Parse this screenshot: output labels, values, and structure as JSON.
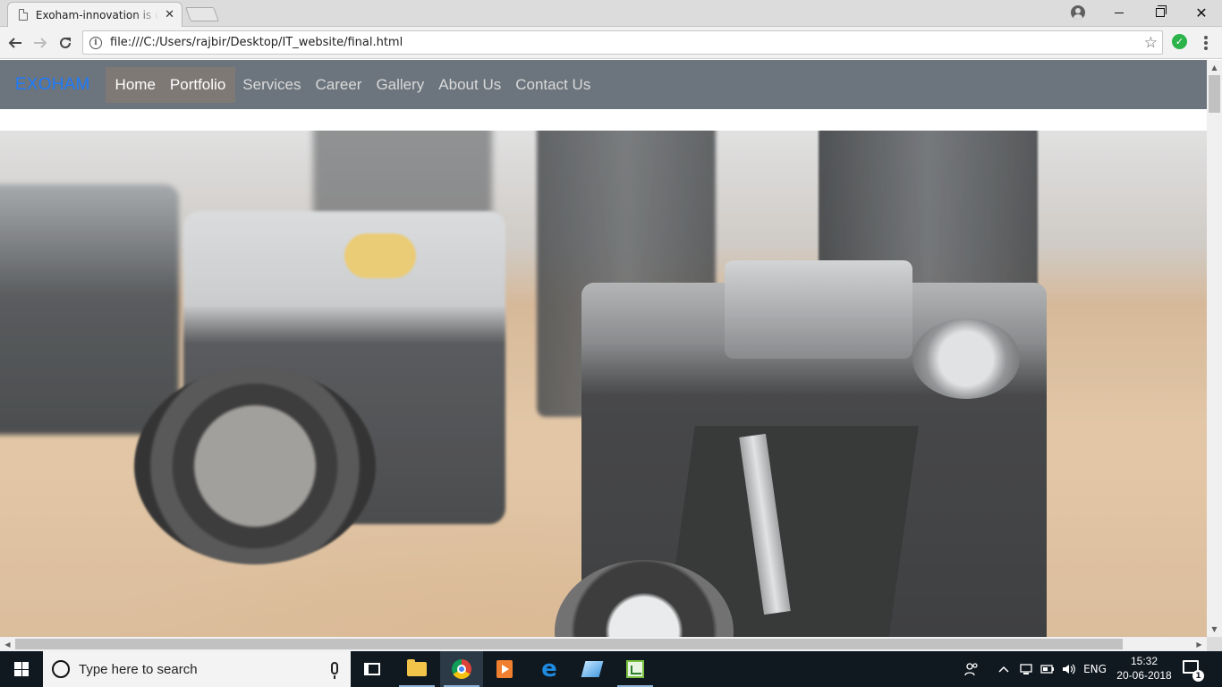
{
  "browser": {
    "tab_title": "Exoham-innovation is dre",
    "tab_close": "✕",
    "url": "file:///C:/Users/rajbir/Desktop/IT_website/final.html",
    "back_icon": "arrow-left-icon",
    "forward_icon": "arrow-right-icon",
    "reload_icon": "reload-icon",
    "window_buttons": {
      "close": "✕"
    }
  },
  "site": {
    "brand": "EXOHAM",
    "brand_color": "#1d7afc",
    "navbar_color": "#6c757d",
    "nav": [
      {
        "label": "Home",
        "active": true
      },
      {
        "label": "Portfolio",
        "active": true
      },
      {
        "label": "Services",
        "active": false
      },
      {
        "label": "Career",
        "active": false
      },
      {
        "label": "Gallery",
        "active": false
      },
      {
        "label": "About Us",
        "active": false
      },
      {
        "label": "Contact Us",
        "active": false
      }
    ],
    "hero": {
      "subject": "vintage-cameras-photo"
    }
  },
  "taskbar": {
    "search_placeholder": "Type here to search",
    "language": "ENG",
    "time": "15:32",
    "date": "20-06-2018",
    "notification_count": "1",
    "apps": [
      "task-view-icon",
      "file-explorer-icon",
      "chrome-icon",
      "media-player-icon",
      "edge-icon",
      "notepad-icon",
      "spreadsheet-app-icon"
    ]
  }
}
